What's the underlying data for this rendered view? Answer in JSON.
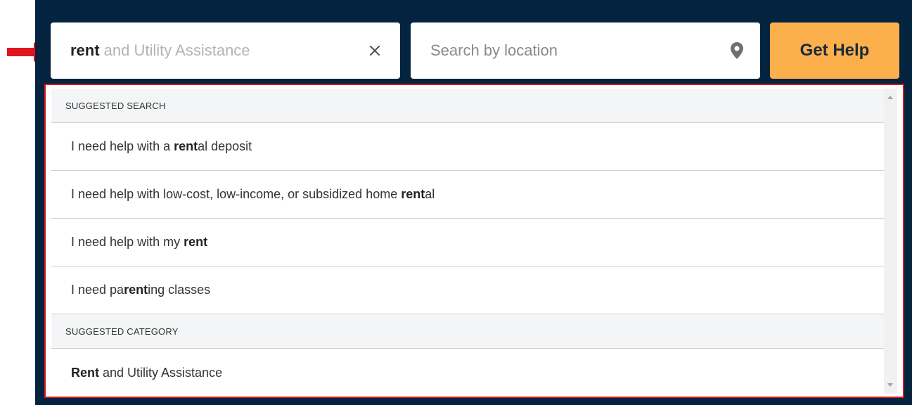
{
  "search": {
    "typed_text": "rent",
    "autocomplete_suffix": " and Utility Assistance",
    "clear_icon": "close-icon",
    "location_placeholder": "Search by location",
    "location_icon": "map-pin-icon",
    "submit_label": "Get Help"
  },
  "dropdown": {
    "suggested_search_header": "SUGGESTED SEARCH",
    "suggested_searches": [
      {
        "before": "I need help with a ",
        "match": "rent",
        "after": "al deposit"
      },
      {
        "before": "I need help with low-cost, low-income, or subsidized home ",
        "match": "rent",
        "after": "al"
      },
      {
        "before": "I need help with my ",
        "match": "rent",
        "after": ""
      },
      {
        "before": "I need pa",
        "match": "rent",
        "after": "ing classes"
      }
    ],
    "suggested_category_header": "SUGGESTED CATEGORY",
    "suggested_categories": [
      {
        "before": "",
        "match": "Rent",
        "after": " and Utility Assistance"
      }
    ]
  },
  "colors": {
    "background": "#03233f",
    "button": "#fcb04c",
    "annotation": "#e0141d"
  }
}
